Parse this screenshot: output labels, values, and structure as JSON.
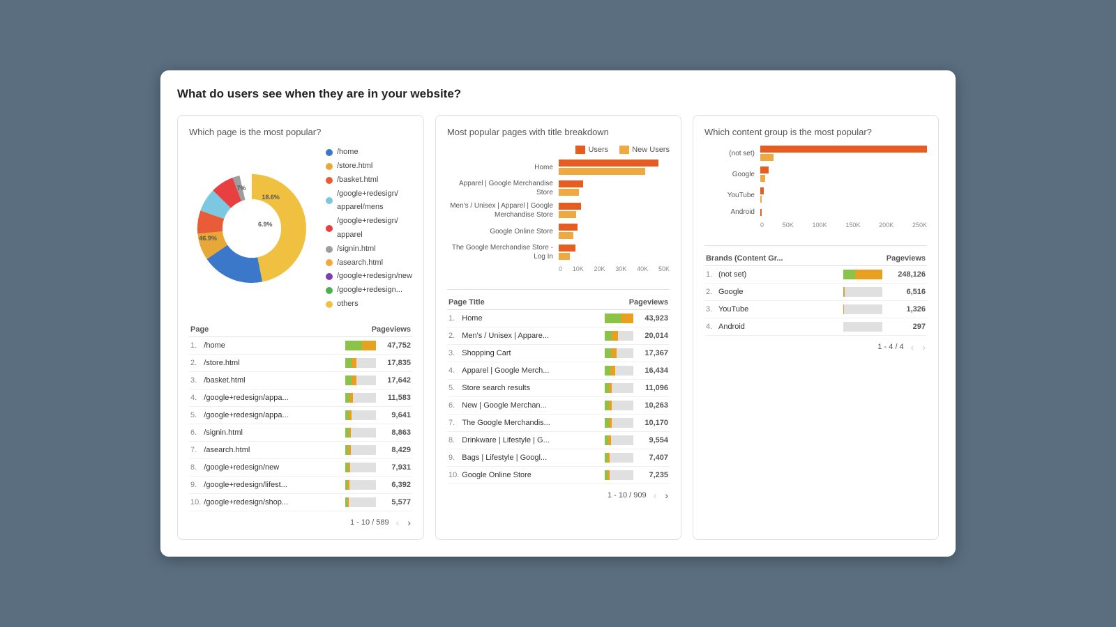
{
  "card": {
    "title": "What do users see when they are in your website?"
  },
  "panel1": {
    "title": "Which page is the most popular?",
    "legend": [
      {
        "label": "/home",
        "color": "#3b78c9"
      },
      {
        "label": "/store.html",
        "color": "#e8a838"
      },
      {
        "label": "/basket.html",
        "color": "#e85c38"
      },
      {
        "label": "/google+redesign/apparel/mens",
        "color": "#7bc8e0"
      },
      {
        "label": "/google+redesign/apparel",
        "color": "#e84040"
      },
      {
        "label": "/signin.html",
        "color": "#9e9e9e"
      },
      {
        "label": "/asearch.html",
        "color": "#f4a836"
      },
      {
        "label": "/google+redesign/new",
        "color": "#7b3fb5"
      },
      {
        "label": "/google+redesign...",
        "color": "#4caf50"
      },
      {
        "label": "others",
        "color": "#f0c040"
      }
    ],
    "donut_labels": [
      {
        "pct": "18.6%",
        "color": "#3b78c9"
      },
      {
        "pct": "7%",
        "color": "#7bc8e0"
      },
      {
        "pct": "6.9%",
        "color": "#e84040"
      },
      {
        "pct": "46.9%",
        "color": "#f0c040"
      }
    ],
    "table": {
      "col1": "Page",
      "col2": "Pageviews",
      "rows": [
        {
          "rank": "1.",
          "page": "/home",
          "views": "47,752",
          "pct": 100
        },
        {
          "rank": "2.",
          "page": "/store.html",
          "views": "17,835",
          "pct": 37
        },
        {
          "rank": "3.",
          "page": "/basket.html",
          "views": "17,642",
          "pct": 37
        },
        {
          "rank": "4.",
          "page": "/google+redesign/appa...",
          "views": "11,583",
          "pct": 24
        },
        {
          "rank": "5.",
          "page": "/google+redesign/appa...",
          "views": "9,641",
          "pct": 20
        },
        {
          "rank": "6.",
          "page": "/signin.html",
          "views": "8,863",
          "pct": 18
        },
        {
          "rank": "7.",
          "page": "/asearch.html",
          "views": "8,429",
          "pct": 17
        },
        {
          "rank": "8.",
          "page": "/google+redesign/new",
          "views": "7,931",
          "pct": 16
        },
        {
          "rank": "9.",
          "page": "/google+redesign/lifest...",
          "views": "6,392",
          "pct": 13
        },
        {
          "rank": "10.",
          "page": "/google+redesign/shop...",
          "views": "5,577",
          "pct": 11
        }
      ],
      "pagination": "1 - 10 / 589"
    }
  },
  "panel2": {
    "title": "Most popular pages with title breakdown",
    "legend": [
      {
        "label": "Users",
        "color": "#e85c20"
      },
      {
        "label": "New Users",
        "color": "#f0a840"
      }
    ],
    "chart_rows": [
      {
        "label": "Home",
        "users_pct": 90,
        "new_pct": 78
      },
      {
        "label": "Apparel | Google Merchandise Store",
        "users_pct": 22,
        "new_pct": 18
      },
      {
        "label": "Men's / Unisex | Apparel | Google Merchandise Store",
        "users_pct": 20,
        "new_pct": 16
      },
      {
        "label": "Google Online Store",
        "users_pct": 17,
        "new_pct": 13
      },
      {
        "label": "The Google Merchandise Store - Log In",
        "users_pct": 15,
        "new_pct": 10
      }
    ],
    "axis_labels": [
      "0",
      "10K",
      "20K",
      "30K",
      "40K",
      "50K"
    ],
    "table": {
      "col1": "Page Title",
      "col2": "Pageviews",
      "rows": [
        {
          "rank": "1.",
          "page": "Home",
          "views": "43,923",
          "pct": 100
        },
        {
          "rank": "2.",
          "page": "Men's / Unisex | Appare...",
          "views": "20,014",
          "pct": 46
        },
        {
          "rank": "3.",
          "page": "Shopping Cart",
          "views": "17,367",
          "pct": 40
        },
        {
          "rank": "4.",
          "page": "Apparel | Google Merch...",
          "views": "16,434",
          "pct": 37
        },
        {
          "rank": "5.",
          "page": "Store search results",
          "views": "11,096",
          "pct": 25
        },
        {
          "rank": "6.",
          "page": "New | Google Merchan...",
          "views": "10,263",
          "pct": 23
        },
        {
          "rank": "7.",
          "page": "The Google Merchandis...",
          "views": "10,170",
          "pct": 23
        },
        {
          "rank": "8.",
          "page": "Drinkware | Lifestyle | G...",
          "views": "9,554",
          "pct": 22
        },
        {
          "rank": "9.",
          "page": "Bags | Lifestyle | Googl...",
          "views": "7,407",
          "pct": 17
        },
        {
          "rank": "10.",
          "page": "Google Online Store",
          "views": "7,235",
          "pct": 16
        }
      ],
      "pagination": "1 - 10 / 909"
    }
  },
  "panel3": {
    "title": "Which content group is the most popular?",
    "chart_rows": [
      {
        "label": "(not set)",
        "users_pct": 100,
        "new_pct": 8
      },
      {
        "label": "Google",
        "users_pct": 5,
        "new_pct": 3
      },
      {
        "label": "YouTube",
        "users_pct": 2,
        "new_pct": 1
      },
      {
        "label": "Android",
        "users_pct": 1,
        "new_pct": 0
      }
    ],
    "axis_labels": [
      "0",
      "50K",
      "100K",
      "150K",
      "200K",
      "250K"
    ],
    "table": {
      "col1": "Brands (Content Gr...",
      "col2": "Pageviews",
      "rows": [
        {
          "rank": "1.",
          "page": "(not set)",
          "views": "248,126",
          "pct": 100
        },
        {
          "rank": "2.",
          "page": "Google",
          "views": "6,516",
          "pct": 3
        },
        {
          "rank": "3.",
          "page": "YouTube",
          "views": "1,326",
          "pct": 1
        },
        {
          "rank": "4.",
          "page": "Android",
          "views": "297",
          "pct": 0
        }
      ],
      "pagination": "1 - 4 / 4"
    }
  },
  "colors": {
    "bar_orange": "#e8a020",
    "bar_green": "#8bc34a",
    "bar_dark_orange": "#e85c20",
    "bar_amber": "#f0a840"
  }
}
